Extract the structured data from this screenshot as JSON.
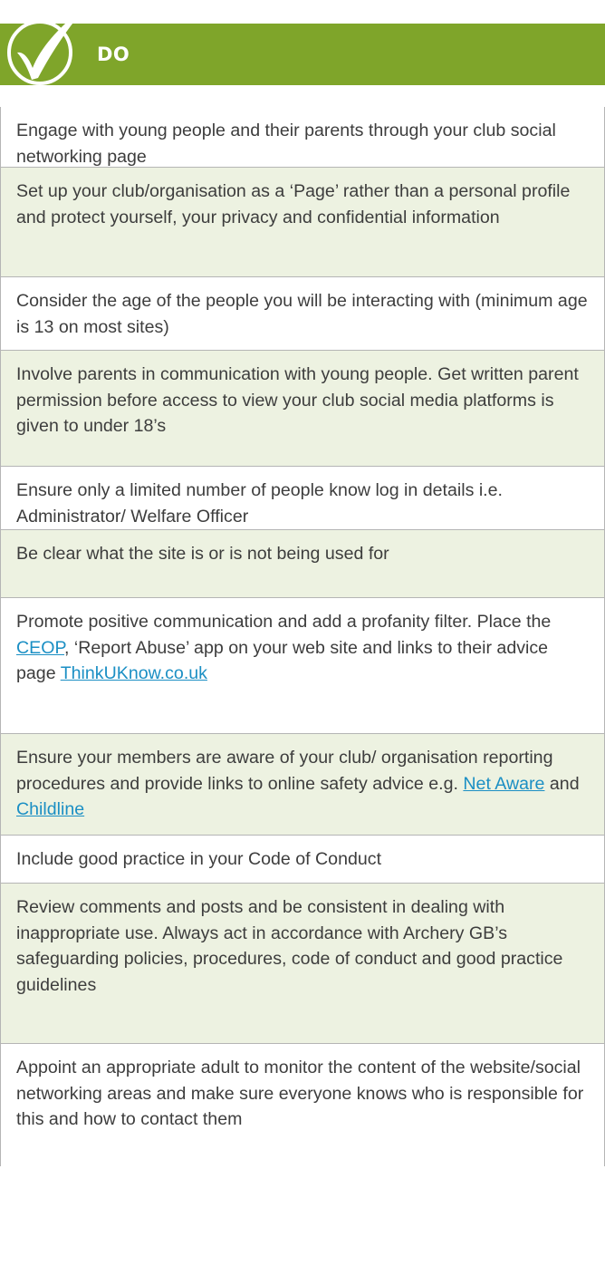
{
  "header": {
    "title": "DO",
    "accent_color": "#7fa52a",
    "icon": "checkmark-icon"
  },
  "items": [
    {
      "text": "Engage with young people and their parents through your club social networking page"
    },
    {
      "text": "Set up your club/organisation as a ‘Page’ rather than a personal profile and protect yourself, your privacy and confidential information"
    },
    {
      "text": "Consider the age of the people you will be interacting with (minimum age is 13 on most sites)"
    },
    {
      "text": "Involve parents in communication with young people. Get written parent permission before access to view your club social media platforms is given to under 18’s"
    },
    {
      "text": "Ensure only a limited number of people know log in details i.e. Administrator/ Welfare Officer"
    },
    {
      "text": "Be clear what the site is or is not being used for"
    },
    {
      "text_a": "Promote positive communication and add a profanity filter. Place the ",
      "link_ceop": "CEOP",
      "text_b": ", ‘Report Abuse’ app on your web site and links to their advice page ",
      "link_thinkuknow": "ThinkUKnow.co.uk"
    },
    {
      "text_a": "Ensure your members are aware of your club/ organisation reporting procedures and provide links to online safety advice e.g. ",
      "link_netaware": "Net Aware",
      "text_b": " and ",
      "link_childline": "Childline"
    },
    {
      "text": "Include good practice in your Code of Conduct"
    },
    {
      "text": "Review comments and posts and be consistent in dealing with inappropriate use. Always act in accordance with Archery GB’s safeguarding policies, procedures, code of conduct and good practice guidelines"
    },
    {
      "text": "Appoint an appropriate adult to monitor the content of the website/social networking areas and make sure everyone knows who is responsible for this and how to contact them"
    }
  ],
  "link_color": "#1b8fc4"
}
